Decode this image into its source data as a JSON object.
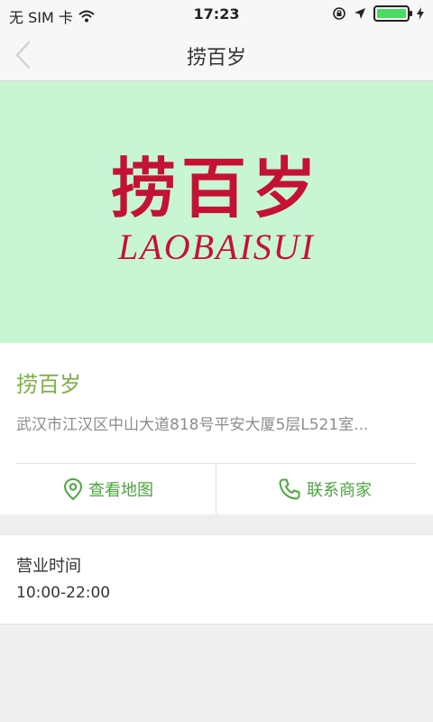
{
  "status_bar": {
    "carrier": "无 SIM 卡",
    "time": "17:23",
    "battery_level": 1.0
  },
  "nav": {
    "title": "捞百岁"
  },
  "banner": {
    "logo_cn": "捞百岁",
    "logo_en": "LAOBAISUI",
    "background_color": "#c8f5d3",
    "logo_color": "#c41235"
  },
  "shop": {
    "name": "捞百岁",
    "address": "武汉市江汉区中山大道818号平安大厦5层L521室..."
  },
  "actions": {
    "map_label": "查看地图",
    "call_label": "联系商家",
    "accent_color": "#4aa83c"
  },
  "hours": {
    "label": "营业时间",
    "value": "10:00-22:00"
  }
}
